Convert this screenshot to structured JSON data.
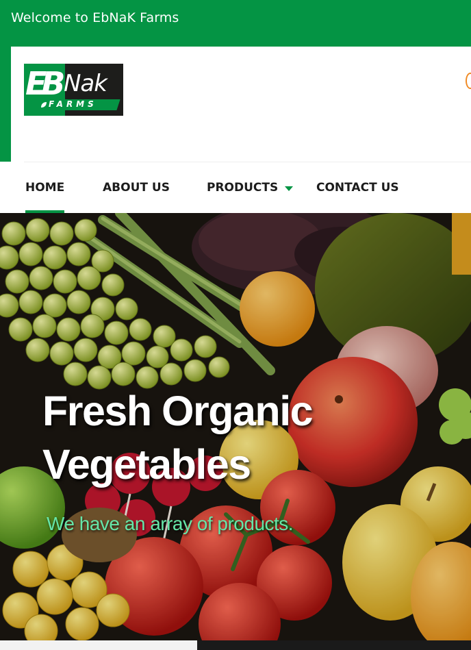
{
  "topbar": {
    "welcome_text": "Welcome to EbNaK Farms"
  },
  "logo": {
    "mark": "EB",
    "name": "Nak",
    "subtitle": "FARMS"
  },
  "nav": {
    "items": [
      {
        "label": "HOME",
        "active": true
      },
      {
        "label": "ABOUT US",
        "active": false
      },
      {
        "label": "PRODUCTS",
        "active": false,
        "has_dropdown": true
      },
      {
        "label": "CONTACT US",
        "active": false
      }
    ]
  },
  "hero": {
    "title": "Fresh Organic Vegetables",
    "subtitle": "We have an array of products."
  },
  "colors": {
    "brand_green": "#049444",
    "accent_orange": "#f08a24",
    "hero_subtitle": "#66e6a8",
    "nav_text": "#1c1c1c"
  },
  "icons": [
    "leaf-icon",
    "chevron-down-icon",
    "browser-edge-icon"
  ]
}
